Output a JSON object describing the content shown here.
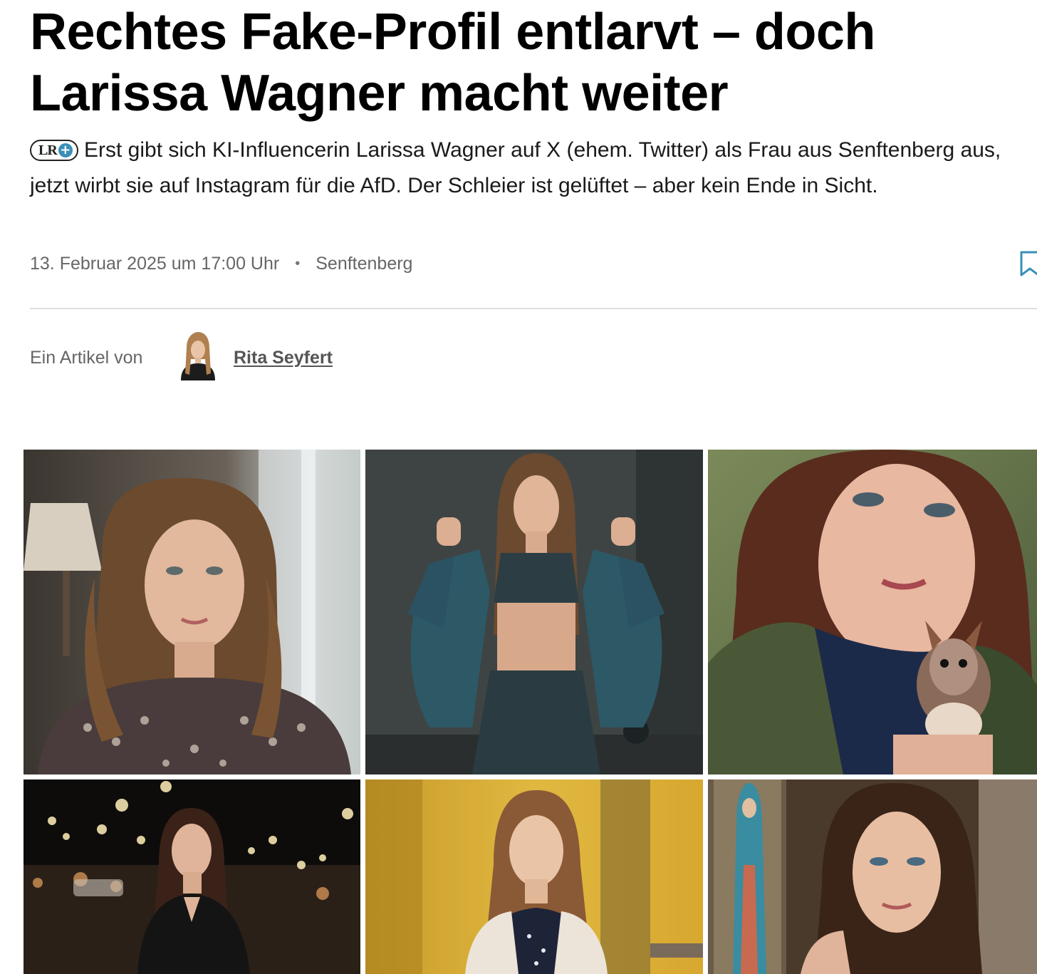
{
  "article": {
    "headline_line1": "Rechtes Fake-Profil entlarvt – doch",
    "headline_line2": "Larissa Wagner macht weiter",
    "badge": "LR",
    "badge_plus_icon": "plus-circle-icon",
    "teaser": "Erst gibt sich KI-Influencerin Larissa Wagner auf X (ehem. Twitter) als Frau aus Senftenberg aus, jetzt wirbt sie auf Instagram für die AfD. Der Schleier ist gelüftet – aber kein Ende in Sicht.",
    "date": "13. Februar 2025 um 17:00 Uhr",
    "separator": "•",
    "location": "Senftenberg",
    "byline_label": "Ein Artikel von",
    "author": "Rita Seyfert"
  },
  "colors": {
    "badge_accent": "#3a8fb8",
    "bookmark": "#3a8fb8",
    "meta_text": "#666666",
    "divider": "#dddddd"
  },
  "gallery": {
    "images": [
      {
        "name": "portrait-sweater-by-window"
      },
      {
        "name": "portrait-fitness-denim-jacket"
      },
      {
        "name": "portrait-closeup-with-squirrel"
      },
      {
        "name": "portrait-city-night-blazer"
      },
      {
        "name": "portrait-autumn-cardigan"
      },
      {
        "name": "portrait-with-madonna-painting"
      }
    ]
  }
}
